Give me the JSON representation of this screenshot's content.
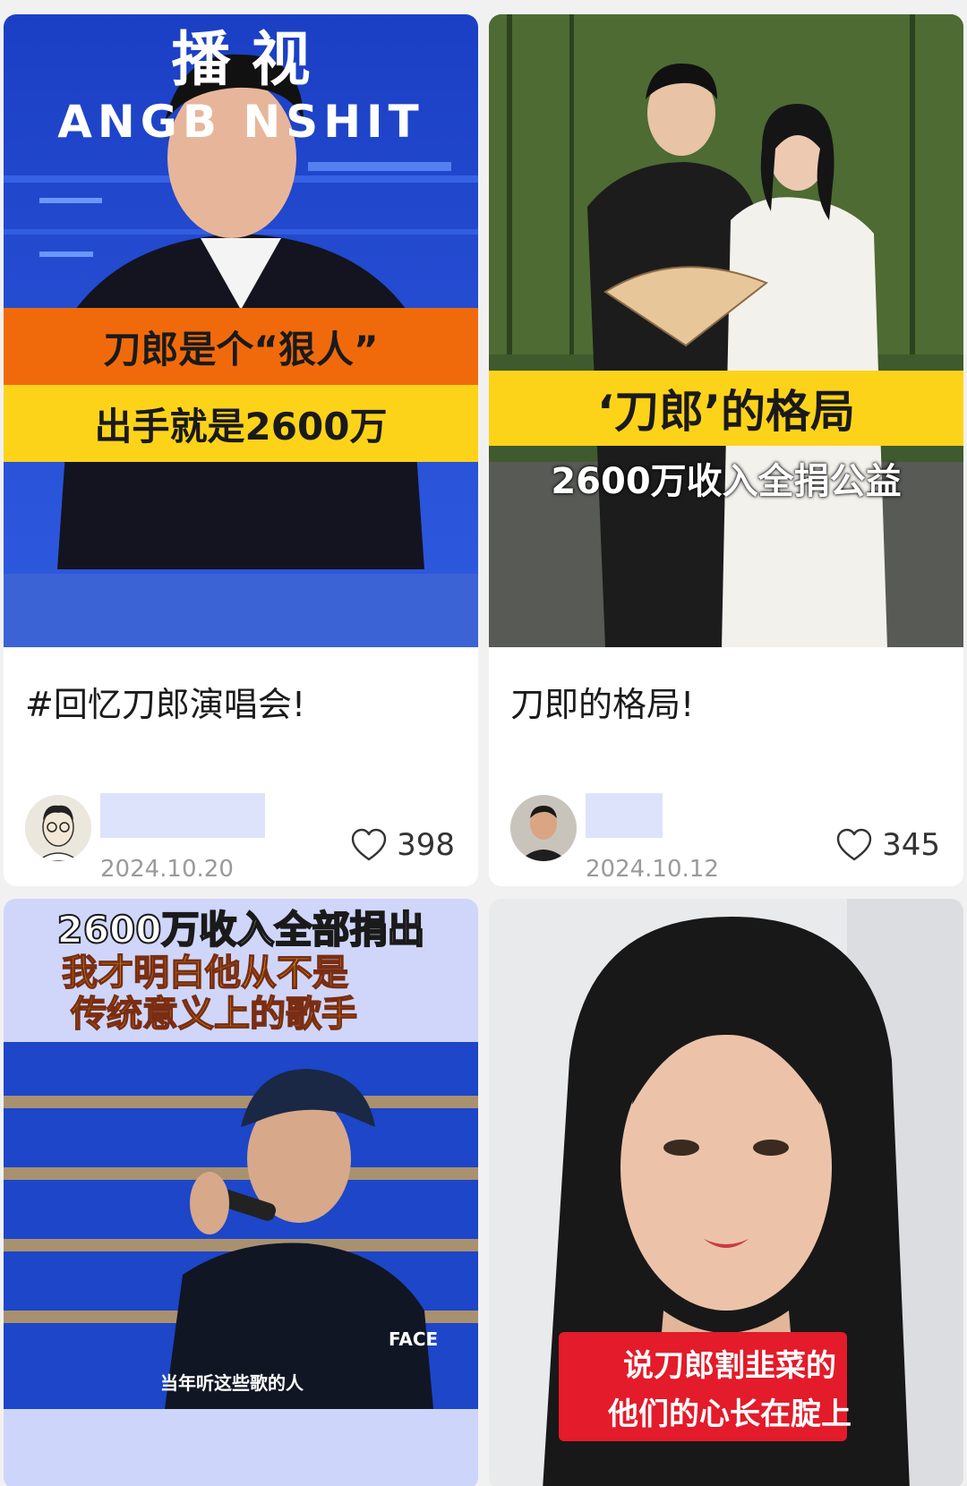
{
  "cards": [
    {
      "thumb_text": {
        "top": "播  视",
        "band": "ANGB   NSHIT",
        "line1": "刀郎是个“狠人”",
        "line2": "出手就是2600万"
      },
      "title": "#回忆刀郎演唱会!",
      "date": "2024.10.20",
      "likes": "398"
    },
    {
      "thumb_text": {
        "line1": "‘刀郎’的格局",
        "line2": "2600万收入全捐公益"
      },
      "title": "刀即的格局!",
      "date": "2024.10.12",
      "likes": "345"
    },
    {
      "thumb_text": {
        "line1": "2600万收入全部捐出",
        "line2": "我才明白他从不是",
        "line3": "传统意义上的歌手",
        "subtitle": "当年听这些歌的人",
        "shirt": "FACE"
      }
    },
    {
      "thumb_text": {
        "line1": "说刀郎割韭菜的",
        "line2": "他们的心长在腚上"
      }
    }
  ],
  "colors": {
    "card_bg": "#ffffff",
    "page_bg": "#f1f1f1",
    "name_placeholder": "#dce3fb",
    "orange_band": "#f06a0c",
    "yellow_band": "#fdd31a",
    "red_caption": "#e31b2a"
  },
  "icons": {
    "like": "heart-outline-icon"
  }
}
